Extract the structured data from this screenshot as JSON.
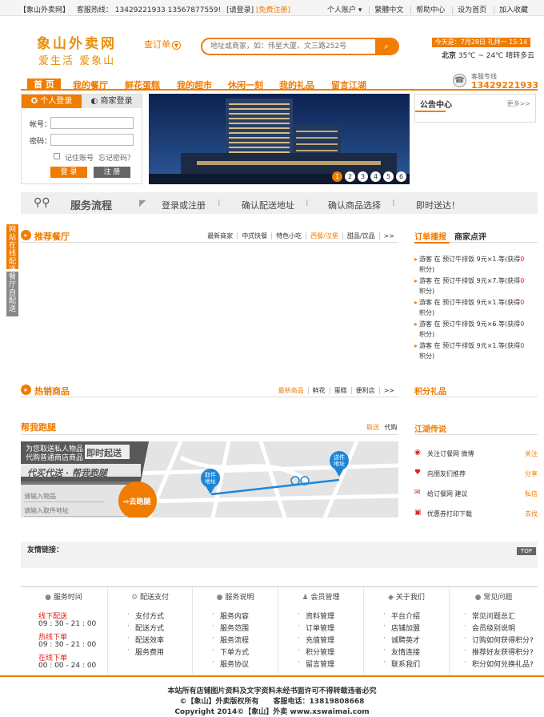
{
  "topbar": {
    "site_name": "【象山外卖网】",
    "hotline_label": "客服热线：",
    "hotline_numbers": "13429221933 13567877559!",
    "login": "[请登录]",
    "register": "[免费注册]",
    "links": [
      "个人账户 ▾",
      "繁體中文",
      "帮助中心",
      "设为首页",
      "加入收藏"
    ]
  },
  "header": {
    "logo_line1": "象山外卖网",
    "logo_line2": "爱生活 爱象山",
    "order_query": "查订单",
    "search_placeholder": "地址或商家，如：伟星大厦、文三路252号",
    "today": "今天是：7月28日 礼拜一 15:14",
    "weather_city": "北京",
    "weather_temp": "35℃ ~ 24℃",
    "weather_desc": "晴转多云",
    "hotline_label": "客服专线",
    "hotline_number": "13429221933"
  },
  "nav": [
    "首 页",
    "我的餐厅",
    "鲜花蛋糕",
    "我的超市",
    "休闲一刻",
    "我的礼品",
    "留言江湖"
  ],
  "login_box": {
    "tab_personal": "个人登录",
    "tab_merchant": "商家登录",
    "account_label": "帐号：",
    "password_label": "密码：",
    "remember": "记住账号",
    "forgot": "忘记密码？",
    "login_btn": "登 录",
    "register_btn": "注 册"
  },
  "banner": {
    "pages": [
      "1",
      "2",
      "3",
      "4",
      "5",
      "6"
    ],
    "active": 0
  },
  "notice": {
    "title": "公告中心",
    "more": "更多>>"
  },
  "flow": {
    "title": "服务流程",
    "steps": [
      "登录或注册",
      "确认配送地址",
      "确认商品选择",
      "即时送达！"
    ]
  },
  "side_tabs": {
    "tab1": "网站在线配送",
    "tab2": "餐厅自配送"
  },
  "recommend": {
    "title": "推荐餐厅",
    "tabs": [
      "最新商家",
      "中式快餐",
      "特色小吃",
      "西餐/汉堡",
      "甜品/饮品",
      ">>"
    ],
    "active_tab": 3
  },
  "orders": {
    "tab_active": "订单播报",
    "tab_other": "商家点评",
    "items": [
      {
        "text": "游客 在 预订牛排饭 9元×1.等(获得",
        "pts": "0",
        "end": "积分)"
      },
      {
        "text": "游客 在 预订牛排饭 9元×7.等(获得",
        "pts": "0",
        "end": "积分)"
      },
      {
        "text": "游客 在 预订牛排饭 9元×1.等(获得",
        "pts": "0",
        "end": "积分)"
      },
      {
        "text": "游客 在 预订牛排饭 9元×6.等(获得",
        "pts": "0",
        "end": "积分)"
      },
      {
        "text": "游客 在 预订牛排饭 9元×1.等(获得",
        "pts": "0",
        "end": "积分)"
      }
    ]
  },
  "hot": {
    "title": "热销商品",
    "tabs": [
      "最新商品",
      "鲜花",
      "蛋糕",
      "便利店",
      ">>"
    ],
    "active_tab": 0
  },
  "gifts": {
    "title": "积分礼品"
  },
  "errand": {
    "title": "帮我跑腿",
    "tab_active": "取送",
    "tab_other": "代购",
    "slogan1": "为您取送私人物品",
    "slogan2": "代购普通商店商品",
    "badge": "即时起送",
    "banner": "代买代送 · 帮我跑腿",
    "input_item": "请输入物品",
    "input_address": "请输入取件地址",
    "go_btn": "去跑腿",
    "pin_pickup": "取件地址",
    "pin_send": "送件地址"
  },
  "jianghu": {
    "title": "江湖传说",
    "items": [
      {
        "icon": "weibo-icon",
        "glyph": "◉",
        "text": "关注订餐网 微博",
        "action": "关注"
      },
      {
        "icon": "heart-icon",
        "glyph": "♥",
        "text": "向朋友们推荐",
        "action": "分享"
      },
      {
        "icon": "mail-icon",
        "glyph": "✉",
        "text": "给订餐网 建议",
        "action": "私信"
      },
      {
        "icon": "coupon-icon",
        "glyph": "▣",
        "text": "优惠券打印下载",
        "action": "去找"
      }
    ]
  },
  "friend_links": {
    "title": "友情链接：",
    "top": "TOP"
  },
  "footer": {
    "cols": [
      {
        "title": "服务时间",
        "icon": "●",
        "items": []
      },
      {
        "title": "配送支付",
        "icon": "⚙",
        "items": [
          "支付方式",
          "配送方式",
          "配送效率",
          "服务费用"
        ]
      },
      {
        "title": "服务说明",
        "icon": "●",
        "items": [
          "服务内容",
          "服务范围",
          "服务流程",
          "下单方式",
          "服务协议"
        ]
      },
      {
        "title": "会员管理",
        "icon": "♟",
        "items": [
          "资料管理",
          "订单管理",
          "充值管理",
          "积分管理",
          "留言管理"
        ]
      },
      {
        "title": "关于我们",
        "icon": "◆",
        "items": [
          "平台介绍",
          "店铺加盟",
          "诚聘英才",
          "友情连接",
          "联系我们"
        ]
      },
      {
        "title": "常见问题",
        "icon": "●",
        "items": [
          "常见问题总汇",
          "会员级别说明",
          "订购如何获得积分?",
          "推荐好友获得积分?",
          "积分如何兑换礼品?"
        ]
      }
    ],
    "service_times": [
      {
        "label": "线下配送",
        "time": "09 : 30 - 21 : 00"
      },
      {
        "label": "热线下单",
        "time": "09 : 30 - 21 : 00"
      },
      {
        "label": "在线下单",
        "time": "00 : 00 - 24 : 00"
      }
    ],
    "copy1": "本站所有店铺图片资料及文字资料未经书面许可不得转载违者必究",
    "copy2": "©【象山】外卖版权所有　　客服电话：13819808668",
    "copy3": "Copyright 2014©【象山】外卖 www.xswaimai.com"
  },
  "colors": {
    "accent": "#f07c00",
    "red": "#e0201a",
    "gray": "#efefef"
  }
}
